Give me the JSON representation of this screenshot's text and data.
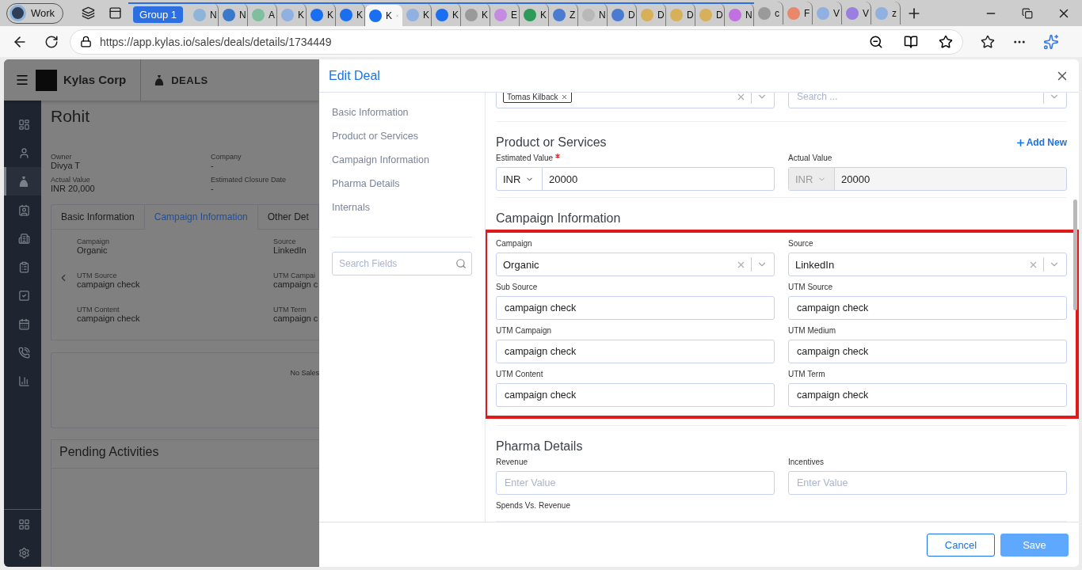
{
  "browser": {
    "profile": "Work",
    "tab_group": {
      "label": "Group 1",
      "tabs": [
        {
          "title": "N",
          "color": "#8fb4d9",
          "selected": false
        },
        {
          "title": "N",
          "color": "#3a78c9",
          "selected": false
        },
        {
          "title": "A",
          "color": "#7fbf9f",
          "selected": false
        },
        {
          "title": "K",
          "color": "#8fb0e0",
          "selected": false
        },
        {
          "title": "K",
          "color": "#1a6ff0",
          "selected": false
        },
        {
          "title": "K",
          "color": "#1a6ff0",
          "selected": false
        },
        {
          "title": "K",
          "color": "#1a6ff0",
          "selected": true
        },
        {
          "title": "K",
          "color": "#8fb0e0",
          "selected": false
        },
        {
          "title": "K",
          "color": "#1a6ff0",
          "selected": false
        },
        {
          "title": "K",
          "color": "#9a9a9a",
          "selected": false
        },
        {
          "title": "E",
          "color": "#c58be0",
          "selected": false
        },
        {
          "title": "K",
          "color": "#2e9b5a",
          "selected": false
        },
        {
          "title": "Z",
          "color": "#4a7bd0",
          "selected": false
        },
        {
          "title": "N",
          "color": "#b8b8b8",
          "selected": false
        },
        {
          "title": "D",
          "color": "#4a7bd0",
          "selected": false
        },
        {
          "title": "D",
          "color": "#d8b05a",
          "selected": false
        },
        {
          "title": "D",
          "color": "#d8b05a",
          "selected": false
        },
        {
          "title": "D",
          "color": "#d8b05a",
          "selected": false
        },
        {
          "title": "N",
          "color": "#c070e0",
          "selected": false
        }
      ]
    },
    "tabs": [
      {
        "title": "c",
        "color": "#9a9a9a",
        "selected": false
      },
      {
        "title": "F",
        "color": "#e8876a",
        "selected": false
      },
      {
        "title": "V",
        "color": "#8fb0e0",
        "selected": false
      },
      {
        "title": "V",
        "color": "#9a7ee0",
        "selected": false
      },
      {
        "title": "z",
        "color": "#8fb0e0",
        "selected": false
      }
    ],
    "url": "https://app.kylas.io/sales/deals/details/1734449"
  },
  "app": {
    "company": "Kylas Corp",
    "module": "DEALS",
    "nav": [
      {
        "selected": false
      },
      {
        "selected": false
      },
      {
        "selected": true
      },
      {
        "selected": false
      },
      {
        "selected": false
      },
      {
        "selected": false
      },
      {
        "selected": false
      },
      {
        "selected": false
      },
      {
        "selected": false
      },
      {
        "selected": false
      }
    ],
    "bottom_nav": [
      {
        "selected": false
      },
      {
        "selected": false
      }
    ],
    "deal": {
      "name": "Rohit",
      "summary": [
        {
          "label": "Owner",
          "value": "Divya T"
        },
        {
          "label": "Company",
          "value": "-"
        },
        {
          "label": "Actual Value",
          "value": "INR 20,000"
        },
        {
          "label": "Estimated Closure Date",
          "value": "-"
        }
      ],
      "tabs": [
        {
          "label": "Basic Information",
          "selected": false
        },
        {
          "label": "Campaign Information",
          "selected": true
        },
        {
          "label": "Other Det",
          "selected": false
        }
      ],
      "fields": [
        {
          "label": "Campaign",
          "value": "Organic"
        },
        {
          "label": "Source",
          "value": "LinkedIn"
        },
        {
          "label": "UTM Source",
          "value": "campaign check"
        },
        {
          "label": "UTM Campai",
          "value": "campaign c"
        },
        {
          "label": "UTM Content",
          "value": "campaign check"
        },
        {
          "label": "UTM Term",
          "value": "campaign c"
        }
      ],
      "empty_text": "No Sales",
      "pending_title": "Pending Activities"
    }
  },
  "modal": {
    "title": "Edit Deal",
    "nav": [
      "Basic Information",
      "Product or Services",
      "Campaign Information",
      "Pharma Details",
      "Internals"
    ],
    "search_placeholder": "Search Fields",
    "top_row": [
      {
        "kind": "chips",
        "chips": [
          "Tomas Kilback"
        ]
      },
      {
        "kind": "search",
        "placeholder": "Search ..."
      }
    ],
    "sections": [
      {
        "title": "Product or Services",
        "action": "Add New",
        "highlighted": false,
        "fields": [
          {
            "kind": "money",
            "label": "Estimated Value",
            "required": true,
            "currency": "INR",
            "value": "20000",
            "disabled": false
          },
          {
            "kind": "money",
            "label": "Actual Value",
            "required": false,
            "currency": "INR",
            "value": "20000",
            "disabled": true
          }
        ]
      },
      {
        "title": "Campaign Information",
        "highlighted": true,
        "fields": [
          {
            "kind": "select",
            "label": "Campaign",
            "value": "Organic"
          },
          {
            "kind": "select",
            "label": "Source",
            "value": "LinkedIn"
          },
          {
            "kind": "text",
            "label": "Sub Source",
            "value": "campaign check"
          },
          {
            "kind": "text",
            "label": "UTM Source",
            "value": "campaign check"
          },
          {
            "kind": "text",
            "label": "UTM Campaign",
            "value": "campaign check"
          },
          {
            "kind": "text",
            "label": "UTM Medium",
            "value": "campaign check"
          },
          {
            "kind": "text",
            "label": "UTM Content",
            "value": "campaign check"
          },
          {
            "kind": "text",
            "label": "UTM Term",
            "value": "campaign check"
          }
        ]
      },
      {
        "title": "Pharma Details",
        "highlighted": false,
        "fields": [
          {
            "kind": "text",
            "label": "Revenue",
            "placeholder": "Enter Value"
          },
          {
            "kind": "text",
            "label": "Incentives",
            "placeholder": "Enter Value"
          },
          {
            "kind": "label",
            "label": "Spends Vs. Revenue"
          }
        ]
      }
    ],
    "buttons": [
      {
        "label": "Cancel",
        "kind": "secondary"
      },
      {
        "label": "Save",
        "kind": "primary"
      }
    ]
  }
}
